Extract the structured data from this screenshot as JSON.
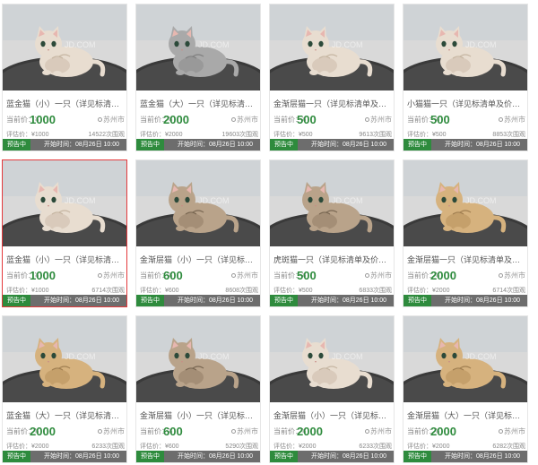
{
  "labels": {
    "price_prefix": "当前价：¥",
    "status_tag": "预告中",
    "start_time": "开始时间：08月26日 10:00"
  },
  "colors": {
    "accent": "#2e8b3d",
    "selected_border": "#e4393c",
    "status_bar": "#6d6d6d"
  },
  "items": [
    {
      "title": "蓝金猫（小）一只（详见标清单及价格说明）",
      "price": "1000",
      "location": "苏州市",
      "estimate": "评估价：¥1000",
      "bids": "14522次围观",
      "status": "预告中",
      "selected": false,
      "cat": "cream"
    },
    {
      "title": "蓝金猫（大）一只（详见标清单及价格说明）",
      "price": "2000",
      "location": "苏州市",
      "estimate": "评估价：¥2000",
      "bids": "19603次围观",
      "status": "预告中",
      "selected": false,
      "cat": "grey"
    },
    {
      "title": "金渐层猫一只（详见标清单及价格说明）",
      "price": "500",
      "location": "苏州市",
      "estimate": "评估价：¥500",
      "bids": "9613次围观",
      "status": "预告中",
      "selected": false,
      "cat": "cream"
    },
    {
      "title": "小猫猫一只（详见标清单及价格说明）",
      "price": "500",
      "location": "苏州市",
      "estimate": "评估价：¥500",
      "bids": "8853次围观",
      "status": "预告中",
      "selected": false,
      "cat": "cream"
    },
    {
      "title": "蓝金猫（小）一只（详见标清单及价格说明）",
      "price": "1000",
      "location": "苏州市",
      "estimate": "评估价：¥1000",
      "bids": "6714次围观",
      "status": "预告中",
      "selected": true,
      "cat": "cream"
    },
    {
      "title": "金渐层猫（小）一只（详见标清单及价格说明）",
      "price": "600",
      "location": "苏州市",
      "estimate": "评估价：¥600",
      "bids": "8608次围观",
      "status": "预告中",
      "selected": false,
      "cat": "tabby"
    },
    {
      "title": "虎斑猫一只（详见标清单及价格说明）",
      "price": "500",
      "location": "苏州市",
      "estimate": "评估价：¥500",
      "bids": "6833次围观",
      "status": "预告中",
      "selected": false,
      "cat": "tabby"
    },
    {
      "title": "金渐层猫一只（详见标清单及价格说明）",
      "price": "2000",
      "location": "苏州市",
      "estimate": "评估价：¥2000",
      "bids": "6714次围观",
      "status": "预告中",
      "selected": false,
      "cat": "golden"
    },
    {
      "title": "蓝金猫（大）一只（详见标清单及价格说明）",
      "price": "2000",
      "location": "苏州市",
      "estimate": "评估价：¥2000",
      "bids": "6233次围观",
      "status": "预告中",
      "selected": false,
      "cat": "golden"
    },
    {
      "title": "金渐层猫（小）一只（详见标清单及价格说明）",
      "price": "600",
      "location": "苏州市",
      "estimate": "评估价：¥600",
      "bids": "5290次围观",
      "status": "预告中",
      "selected": false,
      "cat": "tabby"
    },
    {
      "title": "金渐层猫（小）一只（详见标清单及价格说明）",
      "price": "2000",
      "location": "苏州市",
      "estimate": "评估价：¥2000",
      "bids": "6233次围观",
      "status": "预告中",
      "selected": false,
      "cat": "cream"
    },
    {
      "title": "金渐层猫（大）一只（详见标清单及价格说明）",
      "price": "2000",
      "location": "苏州市",
      "estimate": "评估价：¥2000",
      "bids": "6282次围观",
      "status": "预告中",
      "selected": false,
      "cat": "golden"
    }
  ]
}
